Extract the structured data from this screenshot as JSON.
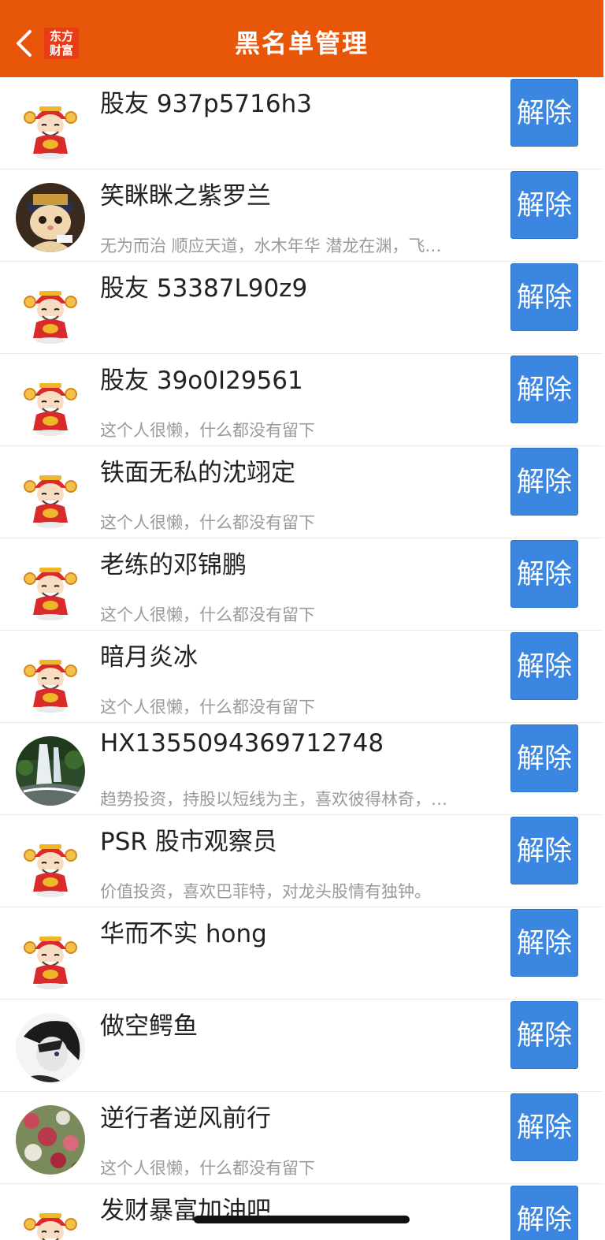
{
  "header": {
    "title": "黑名单管理",
    "logo_line1": "东方",
    "logo_line2": "财富",
    "accent_color": "#e8560a"
  },
  "button_color": "#3b86e0",
  "rows": [
    {
      "name": "股友 937p5716h3",
      "bio": "",
      "button": "解除",
      "avatar": "caishen-avatar"
    },
    {
      "name": "笑眯眯之紫罗兰",
      "bio": "无为而治 顺应天道，水木年华 潜龙在渊，飞…",
      "button": "解除",
      "avatar": "cat-avatar"
    },
    {
      "name": "股友 53387L90z9",
      "bio": "",
      "button": "解除",
      "avatar": "caishen-avatar"
    },
    {
      "name": "股友 39o0I29561",
      "bio": "这个人很懒，什么都没有留下",
      "button": "解除",
      "avatar": "caishen-avatar"
    },
    {
      "name": "铁面无私的沈翊定",
      "bio": "这个人很懒，什么都没有留下",
      "button": "解除",
      "avatar": "caishen-avatar"
    },
    {
      "name": "老练的邓锦鹏",
      "bio": "这个人很懒，什么都没有留下",
      "button": "解除",
      "avatar": "caishen-avatar"
    },
    {
      "name": "暗月炎冰",
      "bio": "这个人很懒，什么都没有留下",
      "button": "解除",
      "avatar": "caishen-avatar"
    },
    {
      "name": "HX1355094369712748",
      "bio": "趋势投资，持股以短线为主，喜欢彼得林奇，…",
      "button": "解除",
      "avatar": "waterfall-avatar"
    },
    {
      "name": "PSR 股市观察员",
      "bio": "价值投资，喜欢巴菲特，对龙头股情有独钟。",
      "button": "解除",
      "avatar": "caishen-avatar"
    },
    {
      "name": "华而不实 hong",
      "bio": "",
      "button": "解除",
      "avatar": "caishen-avatar"
    },
    {
      "name": "做空鳄鱼",
      "bio": "",
      "button": "解除",
      "avatar": "anime-avatar"
    },
    {
      "name": "逆行者逆风前行",
      "bio": "这个人很懒，什么都没有留下",
      "button": "解除",
      "avatar": "flowers-avatar"
    },
    {
      "name": "发财暴富加油吧",
      "bio": "",
      "button": "解除",
      "avatar": "caishen-avatar"
    }
  ]
}
